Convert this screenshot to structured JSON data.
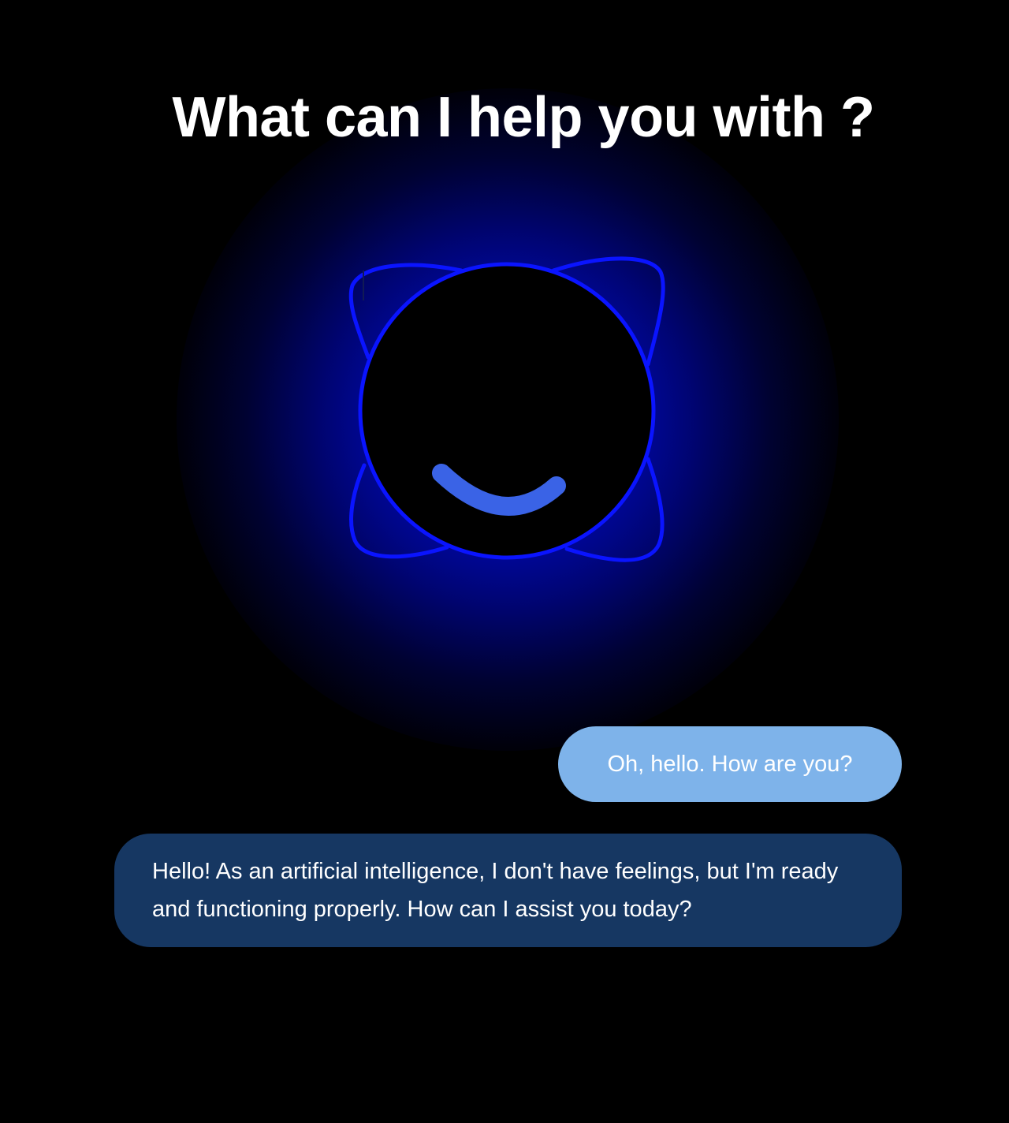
{
  "header": {
    "title": "What can I help you with ?"
  },
  "assistant_avatar": {
    "icon": "smiling-orb-icon",
    "outline_color": "#0a14ff",
    "smile_color": "#3a63e6",
    "glow_color": "#000cbe"
  },
  "conversation": {
    "messages": [
      {
        "role": "user",
        "text": "Oh, hello. How are you?"
      },
      {
        "role": "assistant",
        "text": "Hello! As an artificial intelligence, I don't have feelings, but I'm ready and functioning properly. How can I assist you today?"
      }
    ]
  },
  "colors": {
    "background": "#000000",
    "user_bubble": "#7eb3ea",
    "assistant_bubble": "#163762",
    "text": "#ffffff"
  }
}
